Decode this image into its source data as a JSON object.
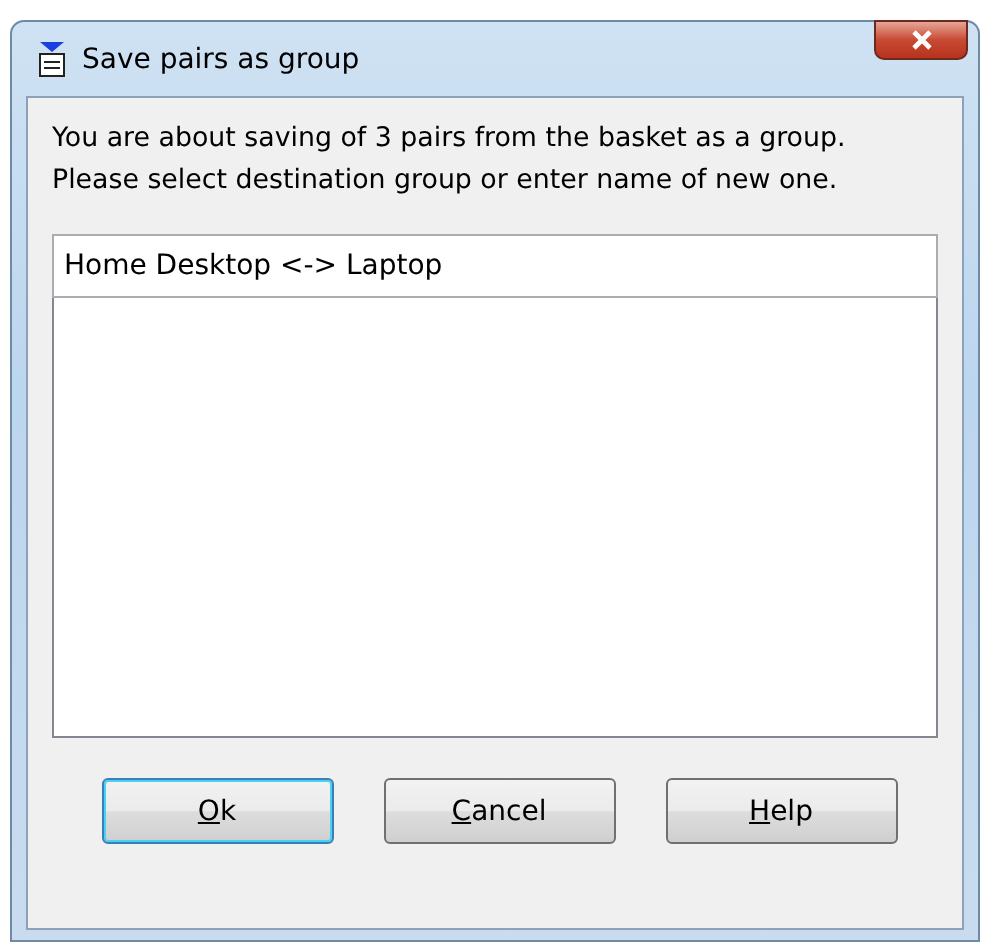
{
  "window": {
    "title": "Save pairs as group"
  },
  "message": "You are about saving of 3 pairs from the basket as a group. Please select destination group or enter name of new one.",
  "group_name": {
    "value": "Home Desktop <-> Laptop"
  },
  "buttons": [
    {
      "label": "Ok",
      "default": true
    },
    {
      "label": "Cancel",
      "default": false
    },
    {
      "label": "Help",
      "default": false
    }
  ]
}
